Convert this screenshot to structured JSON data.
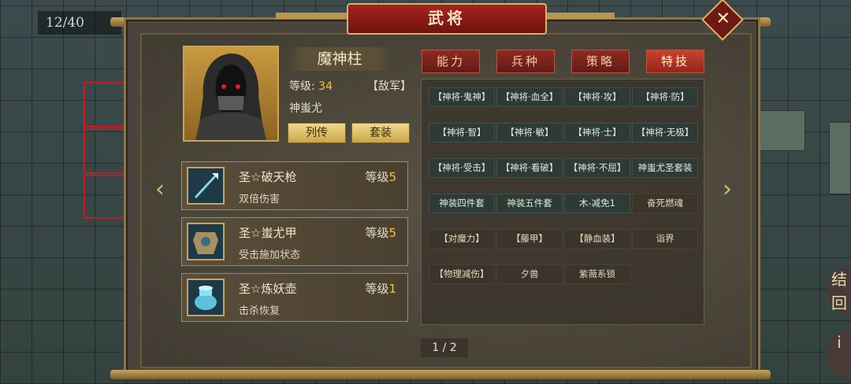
{
  "hud": {
    "turn_counter": "12/40"
  },
  "window": {
    "title": "武将",
    "close_symbol": "✕"
  },
  "general": {
    "name": "魔神柱",
    "level_label": "等级:",
    "level_value": "34",
    "faction_tag": "【敌军】",
    "hero_type": "神蚩尤",
    "buttons": {
      "biography": "列传",
      "equipment_set": "套装"
    }
  },
  "tabs": [
    {
      "label": "能力",
      "active": false
    },
    {
      "label": "兵种",
      "active": false
    },
    {
      "label": "策略",
      "active": false
    },
    {
      "label": "特技",
      "active": true
    }
  ],
  "skills": [
    [
      "【神将·鬼神】",
      "【神将·血全】",
      "【神将·攻】",
      "【神将·防】"
    ],
    [
      "【神将·智】",
      "【神将·敏】",
      "【神将·士】",
      "【神将·无极】"
    ],
    [
      "【神将·受击】",
      "【神将·看破】",
      "【神将·不屈】",
      "神蚩尤圣套装"
    ],
    [
      "神装四件套",
      "神装五件套",
      "木-减免1",
      "奋死燃魂"
    ],
    [
      "【对魔力】",
      "【藤甲】",
      "【静血装】",
      "诣界"
    ],
    [
      "【物理减伤】",
      "夕兽",
      "紫薇系锁"
    ]
  ],
  "items": [
    {
      "name": "圣☆破天枪",
      "level_label": "等级",
      "level": "5",
      "desc": "双倍伤害",
      "icon": "spear-icon"
    },
    {
      "name": "圣☆蚩尤甲",
      "level_label": "等级",
      "level": "5",
      "desc": "受击施加状态",
      "icon": "armor-icon"
    },
    {
      "name": "圣☆炼妖壶",
      "level_label": "等级",
      "level": "1",
      "desc": "击杀恢复",
      "icon": "pot-icon"
    }
  ],
  "pagination": "1 / 2",
  "nav": {
    "prev": "‹",
    "next": "›"
  },
  "side": {
    "right_button_text": "结\n回"
  },
  "colors": {
    "accent_red": "#8d2b23",
    "gold": "#c9a35a",
    "level_yellow": "#f2c440"
  }
}
